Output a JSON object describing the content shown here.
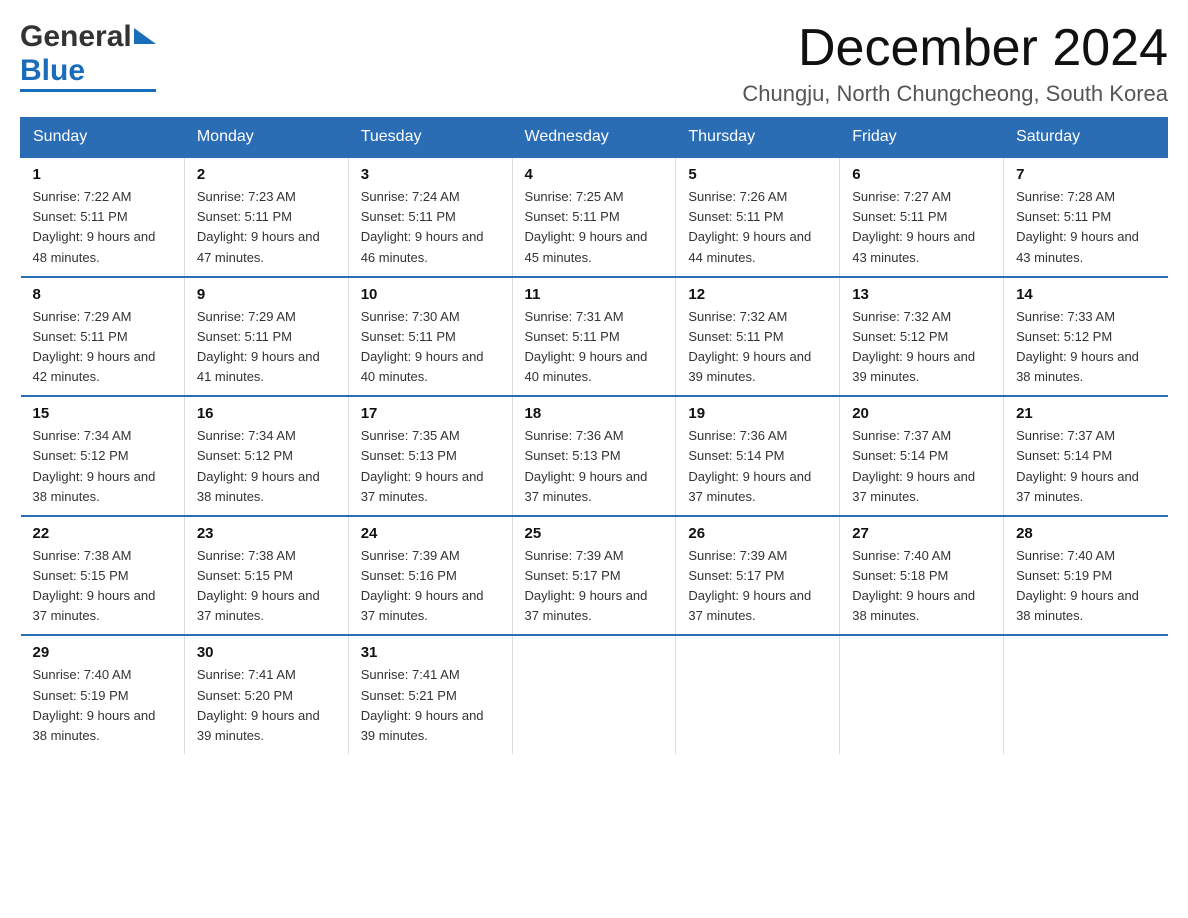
{
  "header": {
    "logo": {
      "general_text": "General",
      "blue_text": "Blue"
    },
    "main_title": "December 2024",
    "subtitle": "Chungju, North Chungcheong, South Korea"
  },
  "calendar": {
    "days_of_week": [
      "Sunday",
      "Monday",
      "Tuesday",
      "Wednesday",
      "Thursday",
      "Friday",
      "Saturday"
    ],
    "weeks": [
      [
        {
          "day": "1",
          "sunrise": "Sunrise: 7:22 AM",
          "sunset": "Sunset: 5:11 PM",
          "daylight": "Daylight: 9 hours and 48 minutes."
        },
        {
          "day": "2",
          "sunrise": "Sunrise: 7:23 AM",
          "sunset": "Sunset: 5:11 PM",
          "daylight": "Daylight: 9 hours and 47 minutes."
        },
        {
          "day": "3",
          "sunrise": "Sunrise: 7:24 AM",
          "sunset": "Sunset: 5:11 PM",
          "daylight": "Daylight: 9 hours and 46 minutes."
        },
        {
          "day": "4",
          "sunrise": "Sunrise: 7:25 AM",
          "sunset": "Sunset: 5:11 PM",
          "daylight": "Daylight: 9 hours and 45 minutes."
        },
        {
          "day": "5",
          "sunrise": "Sunrise: 7:26 AM",
          "sunset": "Sunset: 5:11 PM",
          "daylight": "Daylight: 9 hours and 44 minutes."
        },
        {
          "day": "6",
          "sunrise": "Sunrise: 7:27 AM",
          "sunset": "Sunset: 5:11 PM",
          "daylight": "Daylight: 9 hours and 43 minutes."
        },
        {
          "day": "7",
          "sunrise": "Sunrise: 7:28 AM",
          "sunset": "Sunset: 5:11 PM",
          "daylight": "Daylight: 9 hours and 43 minutes."
        }
      ],
      [
        {
          "day": "8",
          "sunrise": "Sunrise: 7:29 AM",
          "sunset": "Sunset: 5:11 PM",
          "daylight": "Daylight: 9 hours and 42 minutes."
        },
        {
          "day": "9",
          "sunrise": "Sunrise: 7:29 AM",
          "sunset": "Sunset: 5:11 PM",
          "daylight": "Daylight: 9 hours and 41 minutes."
        },
        {
          "day": "10",
          "sunrise": "Sunrise: 7:30 AM",
          "sunset": "Sunset: 5:11 PM",
          "daylight": "Daylight: 9 hours and 40 minutes."
        },
        {
          "day": "11",
          "sunrise": "Sunrise: 7:31 AM",
          "sunset": "Sunset: 5:11 PM",
          "daylight": "Daylight: 9 hours and 40 minutes."
        },
        {
          "day": "12",
          "sunrise": "Sunrise: 7:32 AM",
          "sunset": "Sunset: 5:11 PM",
          "daylight": "Daylight: 9 hours and 39 minutes."
        },
        {
          "day": "13",
          "sunrise": "Sunrise: 7:32 AM",
          "sunset": "Sunset: 5:12 PM",
          "daylight": "Daylight: 9 hours and 39 minutes."
        },
        {
          "day": "14",
          "sunrise": "Sunrise: 7:33 AM",
          "sunset": "Sunset: 5:12 PM",
          "daylight": "Daylight: 9 hours and 38 minutes."
        }
      ],
      [
        {
          "day": "15",
          "sunrise": "Sunrise: 7:34 AM",
          "sunset": "Sunset: 5:12 PM",
          "daylight": "Daylight: 9 hours and 38 minutes."
        },
        {
          "day": "16",
          "sunrise": "Sunrise: 7:34 AM",
          "sunset": "Sunset: 5:12 PM",
          "daylight": "Daylight: 9 hours and 38 minutes."
        },
        {
          "day": "17",
          "sunrise": "Sunrise: 7:35 AM",
          "sunset": "Sunset: 5:13 PM",
          "daylight": "Daylight: 9 hours and 37 minutes."
        },
        {
          "day": "18",
          "sunrise": "Sunrise: 7:36 AM",
          "sunset": "Sunset: 5:13 PM",
          "daylight": "Daylight: 9 hours and 37 minutes."
        },
        {
          "day": "19",
          "sunrise": "Sunrise: 7:36 AM",
          "sunset": "Sunset: 5:14 PM",
          "daylight": "Daylight: 9 hours and 37 minutes."
        },
        {
          "day": "20",
          "sunrise": "Sunrise: 7:37 AM",
          "sunset": "Sunset: 5:14 PM",
          "daylight": "Daylight: 9 hours and 37 minutes."
        },
        {
          "day": "21",
          "sunrise": "Sunrise: 7:37 AM",
          "sunset": "Sunset: 5:14 PM",
          "daylight": "Daylight: 9 hours and 37 minutes."
        }
      ],
      [
        {
          "day": "22",
          "sunrise": "Sunrise: 7:38 AM",
          "sunset": "Sunset: 5:15 PM",
          "daylight": "Daylight: 9 hours and 37 minutes."
        },
        {
          "day": "23",
          "sunrise": "Sunrise: 7:38 AM",
          "sunset": "Sunset: 5:15 PM",
          "daylight": "Daylight: 9 hours and 37 minutes."
        },
        {
          "day": "24",
          "sunrise": "Sunrise: 7:39 AM",
          "sunset": "Sunset: 5:16 PM",
          "daylight": "Daylight: 9 hours and 37 minutes."
        },
        {
          "day": "25",
          "sunrise": "Sunrise: 7:39 AM",
          "sunset": "Sunset: 5:17 PM",
          "daylight": "Daylight: 9 hours and 37 minutes."
        },
        {
          "day": "26",
          "sunrise": "Sunrise: 7:39 AM",
          "sunset": "Sunset: 5:17 PM",
          "daylight": "Daylight: 9 hours and 37 minutes."
        },
        {
          "day": "27",
          "sunrise": "Sunrise: 7:40 AM",
          "sunset": "Sunset: 5:18 PM",
          "daylight": "Daylight: 9 hours and 38 minutes."
        },
        {
          "day": "28",
          "sunrise": "Sunrise: 7:40 AM",
          "sunset": "Sunset: 5:19 PM",
          "daylight": "Daylight: 9 hours and 38 minutes."
        }
      ],
      [
        {
          "day": "29",
          "sunrise": "Sunrise: 7:40 AM",
          "sunset": "Sunset: 5:19 PM",
          "daylight": "Daylight: 9 hours and 38 minutes."
        },
        {
          "day": "30",
          "sunrise": "Sunrise: 7:41 AM",
          "sunset": "Sunset: 5:20 PM",
          "daylight": "Daylight: 9 hours and 39 minutes."
        },
        {
          "day": "31",
          "sunrise": "Sunrise: 7:41 AM",
          "sunset": "Sunset: 5:21 PM",
          "daylight": "Daylight: 9 hours and 39 minutes."
        },
        null,
        null,
        null,
        null
      ]
    ]
  }
}
